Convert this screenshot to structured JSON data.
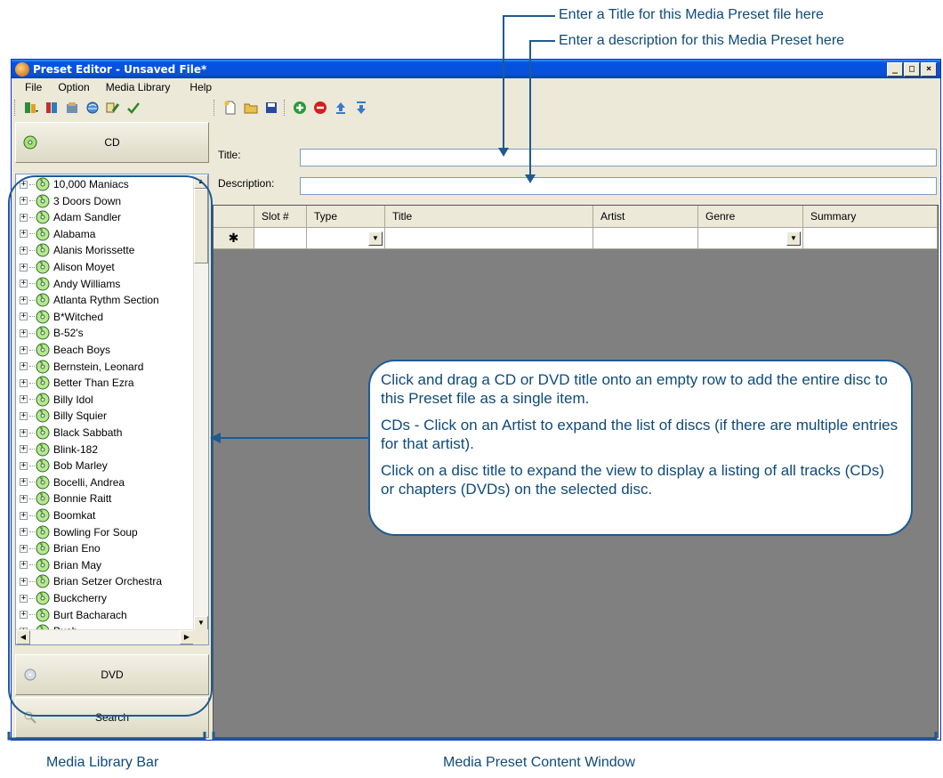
{
  "callouts": {
    "title_hint": "Enter a Title for this Media Preset file here",
    "description_hint": "Enter a description for this Media Preset here",
    "bubble_p1": "Click and drag a CD or DVD title onto an empty row to add the entire disc to this Preset file as a single item.",
    "bubble_p2": "CDs - Click on an Artist to expand the list of discs (if there are multiple entries for that artist).",
    "bubble_p3": "Click on a disc title to expand the view to display a listing of all tracks (CDs) or chapters (DVDs) on the selected disc.",
    "media_library_bar": "Media Library Bar",
    "content_window": "Media Preset Content Window"
  },
  "window": {
    "title": "Preset Editor - Unsaved File*",
    "minimize": "_",
    "maximize": "□",
    "close": "×"
  },
  "menu": [
    "File",
    "Option",
    "Media Library",
    "Help"
  ],
  "library": {
    "cd_label": "CD",
    "dvd_label": "DVD",
    "search_label": "Search",
    "artists": [
      "10,000 Maniacs",
      "3 Doors Down",
      "Adam Sandler",
      "Alabama",
      "Alanis Morissette",
      "Alison Moyet",
      "Andy Williams",
      "Atlanta Rythm Section",
      "B*Witched",
      "B-52's",
      "Beach Boys",
      "Bernstein, Leonard",
      "Better Than Ezra",
      "Billy Idol",
      "Billy Squier",
      "Black Sabbath",
      "Blink-182",
      "Bob Marley",
      "Bocelli, Andrea",
      "Bonnie Raitt",
      "Boomkat",
      "Bowling For Soup",
      "Brian Eno",
      "Brian May",
      "Brian Setzer Orchestra",
      "Buckcherry",
      "Burt Bacharach",
      "Bush"
    ]
  },
  "form": {
    "title_label": "Title:",
    "title_value": "",
    "description_label": "Description:",
    "description_value": ""
  },
  "grid": {
    "columns": [
      "",
      "Slot #",
      "Type",
      "Title",
      "Artist",
      "Genre",
      "Summary"
    ],
    "new_row_marker": "✱"
  }
}
